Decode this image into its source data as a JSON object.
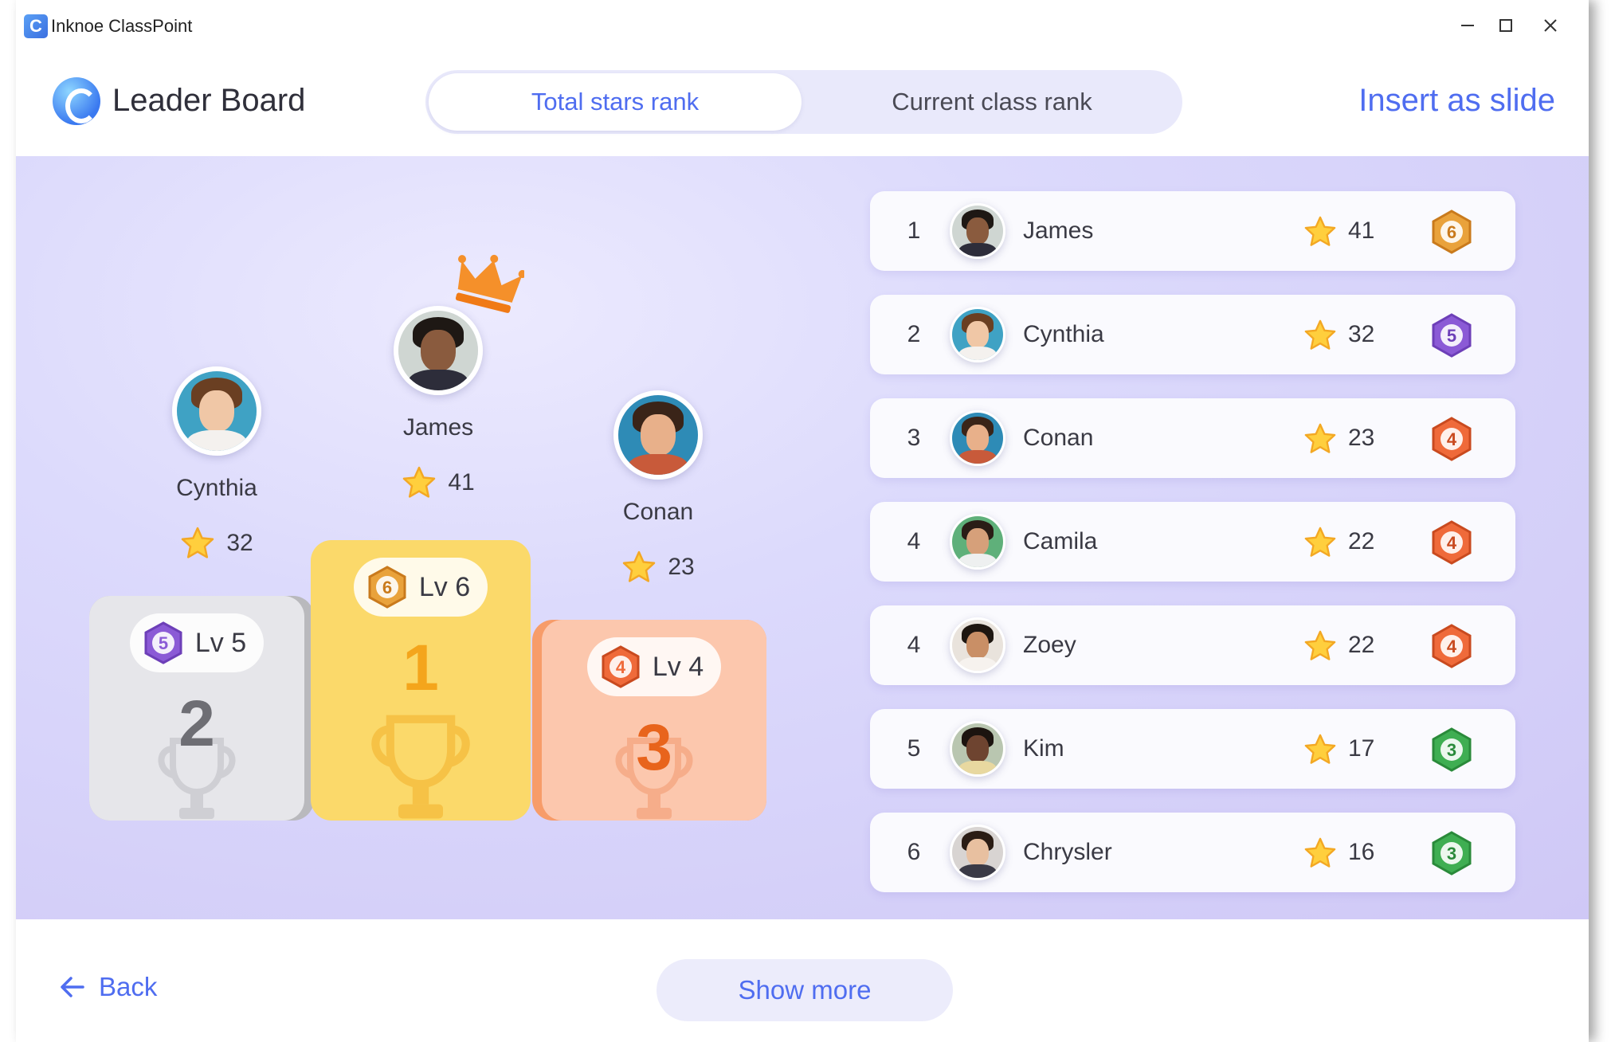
{
  "window": {
    "app_title": "Inknoe ClassPoint"
  },
  "header": {
    "title": "Leader Board",
    "tabs": [
      {
        "label": "Total stars rank",
        "active": true
      },
      {
        "label": "Current class rank",
        "active": false
      }
    ],
    "insert_label": "Insert as slide"
  },
  "podium": {
    "second": {
      "name": "Cynthia",
      "stars": "32",
      "level": "Lv 5",
      "level_num": "5",
      "rank": "2"
    },
    "first": {
      "name": "James",
      "stars": "41",
      "level": "Lv 6",
      "level_num": "6",
      "rank": "1"
    },
    "third": {
      "name": "Conan",
      "stars": "23",
      "level": "Lv 4",
      "level_num": "4",
      "rank": "3"
    }
  },
  "leaderboard": [
    {
      "rank": "1",
      "name": "James",
      "stars": "41",
      "level": "6"
    },
    {
      "rank": "2",
      "name": "Cynthia",
      "stars": "32",
      "level": "5"
    },
    {
      "rank": "3",
      "name": "Conan",
      "stars": "23",
      "level": "4"
    },
    {
      "rank": "4",
      "name": "Camila",
      "stars": "22",
      "level": "4"
    },
    {
      "rank": "4",
      "name": "Zoey",
      "stars": "22",
      "level": "4"
    },
    {
      "rank": "5",
      "name": "Kim",
      "stars": "17",
      "level": "3"
    },
    {
      "rank": "6",
      "name": "Chrysler",
      "stars": "16",
      "level": "3"
    }
  ],
  "footer": {
    "back_label": "Back",
    "show_more_label": "Show more"
  },
  "colors": {
    "accent": "#4f6df0",
    "level6": "#e9a23b",
    "level5": "#8b5ad6",
    "level4": "#ef6a3a",
    "level3": "#3fae52",
    "gold_block": "#fbd96a",
    "silver_block": "#e6e6ea",
    "bronze_block": "#fcc7ad"
  },
  "icons": {
    "app": "classpoint-logo-icon",
    "minimize": "minimize-icon",
    "maximize": "maximize-icon",
    "close": "close-icon",
    "back": "arrow-left-icon",
    "star": "star-icon",
    "crown": "crown-icon",
    "trophy": "trophy-icon",
    "level_badge": "level-badge-icon"
  }
}
